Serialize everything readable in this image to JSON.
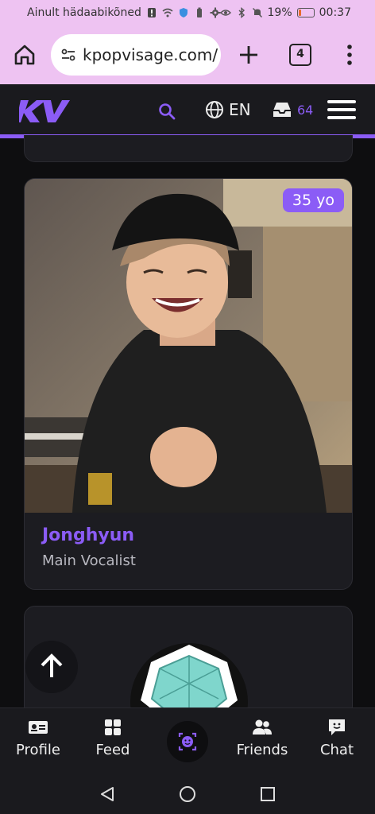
{
  "status_bar": {
    "carrier": "Ainult hädaabikõned",
    "battery": "19%",
    "battery_level": 0.19,
    "time": "00:37"
  },
  "browser": {
    "url": "kpopvisage.com/",
    "tab_count": "4"
  },
  "site_header": {
    "logo_text": "KV",
    "language": "EN",
    "inbox_count": "64",
    "accent": "#8b5cf6"
  },
  "idol_card": {
    "age_badge": "35 yo",
    "name": "Jonghyun",
    "role": "Main Vocalist"
  },
  "bottom_nav": {
    "items": [
      {
        "label": "Profile",
        "icon": "id-card-icon"
      },
      {
        "label": "Feed",
        "icon": "grid-icon"
      },
      {
        "label": "",
        "icon": "face-scan-icon"
      },
      {
        "label": "Friends",
        "icon": "users-icon"
      },
      {
        "label": "Chat",
        "icon": "chat-icon"
      }
    ]
  }
}
